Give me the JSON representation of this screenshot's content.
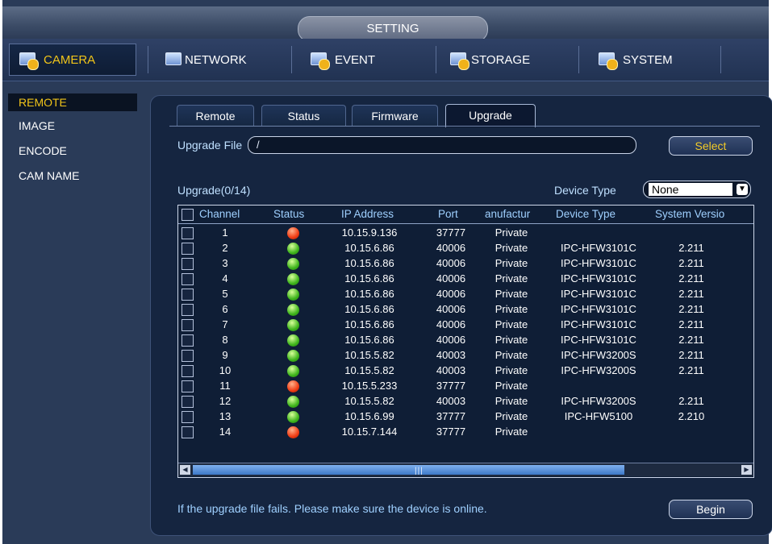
{
  "window": {
    "title": "SETTING"
  },
  "topnav": [
    {
      "label": "CAMERA",
      "icon": "camera-icon",
      "active": true
    },
    {
      "label": "NETWORK",
      "icon": "network-icon",
      "active": false
    },
    {
      "label": "EVENT",
      "icon": "event-icon",
      "active": false
    },
    {
      "label": "STORAGE",
      "icon": "storage-icon",
      "active": false
    },
    {
      "label": "SYSTEM",
      "icon": "system-icon",
      "active": false
    }
  ],
  "sidebar": {
    "items": [
      {
        "label": "REMOTE",
        "active": true
      },
      {
        "label": "IMAGE",
        "active": false
      },
      {
        "label": "ENCODE",
        "active": false
      },
      {
        "label": "CAM NAME",
        "active": false
      }
    ]
  },
  "subtabs": [
    {
      "label": "Remote",
      "active": false
    },
    {
      "label": "Status",
      "active": false
    },
    {
      "label": "Firmware",
      "active": false
    },
    {
      "label": "Upgrade",
      "active": true
    }
  ],
  "upgrade": {
    "file_label": "Upgrade File",
    "file_value": "/",
    "select_label": "Select",
    "count_label": "Upgrade(0/14)",
    "device_type_label": "Device Type",
    "device_type_value": "None",
    "note": "If the upgrade file fails. Please make sure the device is online.",
    "begin_label": "Begin"
  },
  "table": {
    "headers": [
      "Channel",
      "Status",
      "IP Address",
      "Port",
      "anufactur",
      "Device Type",
      "System Versio"
    ],
    "rows": [
      {
        "channel": "1",
        "status": "red",
        "ip": "10.15.9.136",
        "port": "37777",
        "manufacturer": "Private",
        "device_type": "",
        "version": ""
      },
      {
        "channel": "2",
        "status": "green",
        "ip": "10.15.6.86",
        "port": "40006",
        "manufacturer": "Private",
        "device_type": "IPC-HFW3101C",
        "version": "2.211"
      },
      {
        "channel": "3",
        "status": "green",
        "ip": "10.15.6.86",
        "port": "40006",
        "manufacturer": "Private",
        "device_type": "IPC-HFW3101C",
        "version": "2.211"
      },
      {
        "channel": "4",
        "status": "green",
        "ip": "10.15.6.86",
        "port": "40006",
        "manufacturer": "Private",
        "device_type": "IPC-HFW3101C",
        "version": "2.211"
      },
      {
        "channel": "5",
        "status": "green",
        "ip": "10.15.6.86",
        "port": "40006",
        "manufacturer": "Private",
        "device_type": "IPC-HFW3101C",
        "version": "2.211"
      },
      {
        "channel": "6",
        "status": "green",
        "ip": "10.15.6.86",
        "port": "40006",
        "manufacturer": "Private",
        "device_type": "IPC-HFW3101C",
        "version": "2.211"
      },
      {
        "channel": "7",
        "status": "green",
        "ip": "10.15.6.86",
        "port": "40006",
        "manufacturer": "Private",
        "device_type": "IPC-HFW3101C",
        "version": "2.211"
      },
      {
        "channel": "8",
        "status": "green",
        "ip": "10.15.6.86",
        "port": "40006",
        "manufacturer": "Private",
        "device_type": "IPC-HFW3101C",
        "version": "2.211"
      },
      {
        "channel": "9",
        "status": "green",
        "ip": "10.15.5.82",
        "port": "40003",
        "manufacturer": "Private",
        "device_type": "IPC-HFW3200S",
        "version": "2.211"
      },
      {
        "channel": "10",
        "status": "green",
        "ip": "10.15.5.82",
        "port": "40003",
        "manufacturer": "Private",
        "device_type": "IPC-HFW3200S",
        "version": "2.211"
      },
      {
        "channel": "11",
        "status": "red",
        "ip": "10.15.5.233",
        "port": "37777",
        "manufacturer": "Private",
        "device_type": "",
        "version": ""
      },
      {
        "channel": "12",
        "status": "green",
        "ip": "10.15.5.82",
        "port": "40003",
        "manufacturer": "Private",
        "device_type": "IPC-HFW3200S",
        "version": "2.211"
      },
      {
        "channel": "13",
        "status": "green",
        "ip": "10.15.6.99",
        "port": "37777",
        "manufacturer": "Private",
        "device_type": "IPC-HFW5100",
        "version": "2.210"
      },
      {
        "channel": "14",
        "status": "red",
        "ip": "10.15.7.144",
        "port": "37777",
        "manufacturer": "Private",
        "device_type": "",
        "version": ""
      }
    ]
  },
  "colors": {
    "status_online": "#3fb51c",
    "status_offline": "#f03c14",
    "accent": "#f0c419"
  }
}
